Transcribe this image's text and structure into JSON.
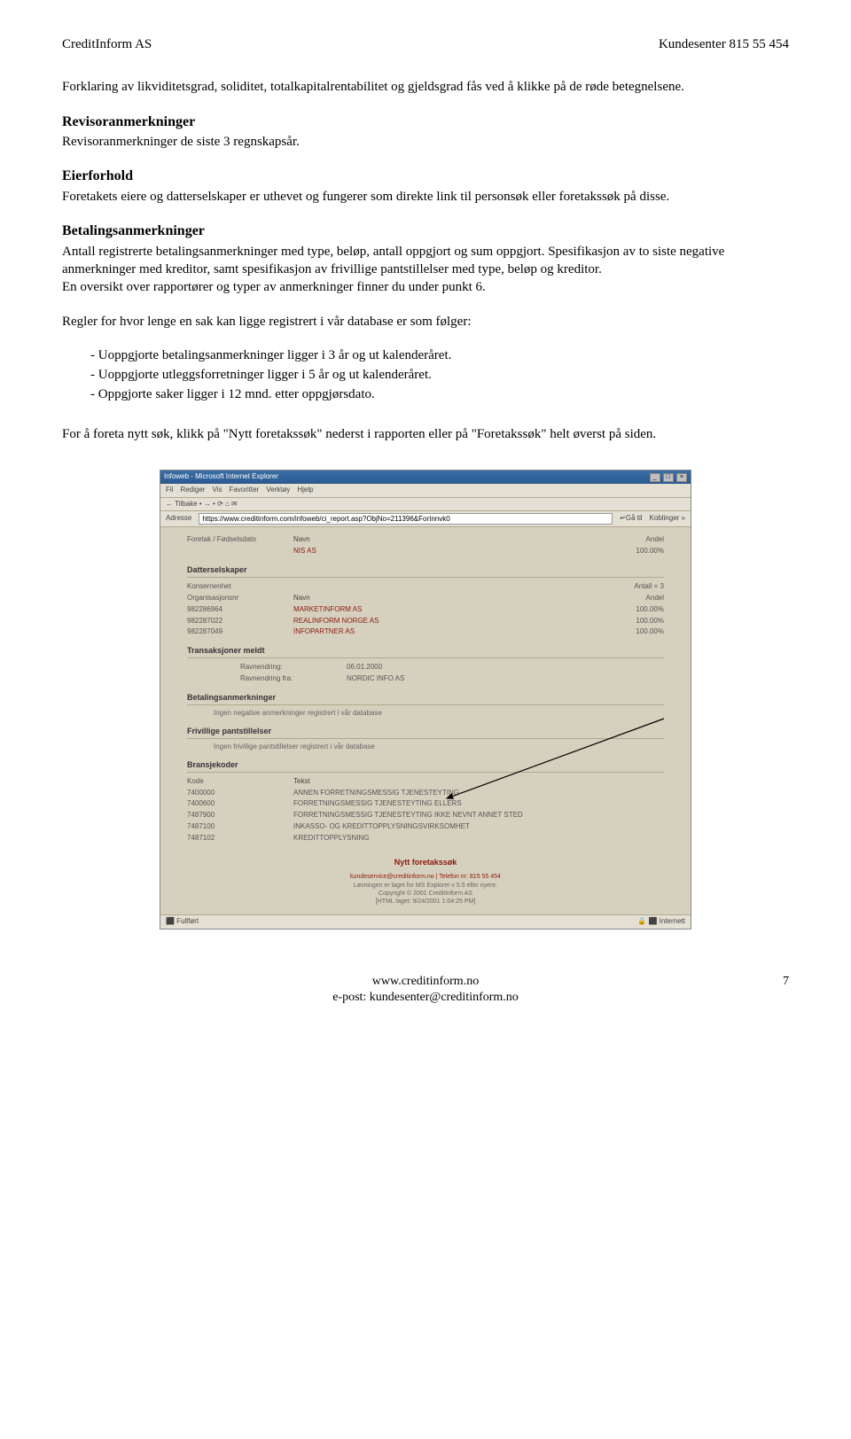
{
  "header": {
    "left": "CreditInform AS",
    "right": "Kundesenter 815 55 454"
  },
  "intro": "Forklaring av likviditetsgrad, soliditet, totalkapitalrentabilitet og gjeldsgrad fås ved å klikke på de røde betegnelsene.",
  "sections": {
    "revisor": {
      "title": "Revisoranmerkninger",
      "body": "Revisoranmerkninger de siste 3 regnskapsår."
    },
    "eier": {
      "title": "Eierforhold",
      "body": "Foretakets eiere og datterselskaper er uthevet og fungerer som direkte link til personsøk eller foretakssøk på disse."
    },
    "betaling": {
      "title": "Betalingsanmerkninger",
      "p1": "Antall registrerte betalingsanmerkninger med type, beløp, antall oppgjort og sum oppgjort. Spesifikasjon av to siste negative anmerkninger med kreditor, samt spesifikasjon av frivillige pantstillelser med type, beløp og kreditor.",
      "p2": "En oversikt over rapportører og typer av anmerkninger finner du under punkt 6.",
      "rules_intro": "Regler for hvor lenge en sak kan ligge registrert i vår database er som følger:",
      "rules": [
        "- Uoppgjorte betalingsanmerkninger ligger i 3 år og ut kalenderåret.",
        "- Uoppgjorte utleggsforretninger ligger i 5 år og ut kalenderåret.",
        "- Oppgjorte saker ligger i 12 mnd. etter oppgjørsdato."
      ]
    }
  },
  "new_search_note": "For å foreta nytt søk, klikk på \"Nytt foretakssøk\" nederst i rapporten eller på \"Foretakssøk\" helt øverst på siden.",
  "screenshot": {
    "title": "Infoweb - Microsoft Internet Explorer",
    "menu": [
      "Fil",
      "Rediger",
      "Vis",
      "Favoritter",
      "Verktøy",
      "Hjelp"
    ],
    "toolbar": "← Tilbake  •  →  •  ⟳  ⌂  ✉",
    "addr_label": "Adresse",
    "url": "https://www.creditinform.com/infoweb/ci_report.asp?ObjNo=211396&ForInnvk0",
    "go": "↵Gå til",
    "links": "Koblinger »",
    "foretak": {
      "head": "Foretak / Fødselsdato",
      "navn_h": "Navn",
      "andel_h": "Andel",
      "navn": "NIS AS",
      "andel": "100.00%"
    },
    "datter": {
      "title": "Datterselskaper",
      "h1": "Konsernenhet",
      "h2": "Antall = 3",
      "oh": "Organisasjonsnr",
      "nh": "Navn",
      "ah": "Andel",
      "rows": [
        {
          "org": "982286964",
          "navn": "MARKETINFORM AS",
          "andel": "100.00%"
        },
        {
          "org": "982287022",
          "navn": "REALINFORM NORGE AS",
          "andel": "100.00%"
        },
        {
          "org": "982287049",
          "navn": "INFOPARTNER AS",
          "andel": "100.00%"
        }
      ]
    },
    "trans": {
      "title": "Transaksjoner meldt",
      "l1": "Ravnendring:",
      "v1": "06.01.2000",
      "l2": "Ravnendring fra:",
      "v2": "NORDIC INFO AS"
    },
    "betal": {
      "title": "Betalingsanmerkninger",
      "msg": "Ingen negative anmerkninger registrert i vår database"
    },
    "pant": {
      "title": "Frivillige pantstillelser",
      "msg": "Ingen frivillige pantstillelser registrert i vår database"
    },
    "bransje": {
      "title": "Bransjekoder",
      "h1": "Kode",
      "h2": "Tekst",
      "rows": [
        {
          "k": "7400000",
          "t": "ANNEN FORRETNINGSMESSIG TJENESTEYTING"
        },
        {
          "k": "7400600",
          "t": "FORRETNINGSMESSIG TJENESTEYTING ELLERS"
        },
        {
          "k": "7487900",
          "t": "FORRETNINGSMESSIG TJENESTEYTING IKKE NEVNT ANNET STED"
        },
        {
          "k": "7487100",
          "t": "INKASSO- OG KREDITTOPPLYSNINGSVIRKSOMHET"
        },
        {
          "k": "7487102",
          "t": "KREDITTOPPLYSNING"
        }
      ]
    },
    "nytt": "Nytt foretakssøk",
    "footer": {
      "l1": "kundeservice@creditinform.no | Telefon nr: 815 55 454",
      "l2": "Løsningen er laget for MS Explorer v 5.5 eller nyere.",
      "l3": "Copyright © 2001 CreditInform AS",
      "l4": "[HTML laget: 9/24/2001 1:04:25 PM]"
    },
    "status_l": "⬛ Fullført",
    "status_r": "🔒 ⬛ Internett"
  },
  "footer": {
    "l1": "www.creditinform.no",
    "l2": "e-post: kundesenter@creditinform.no",
    "page": "7"
  }
}
